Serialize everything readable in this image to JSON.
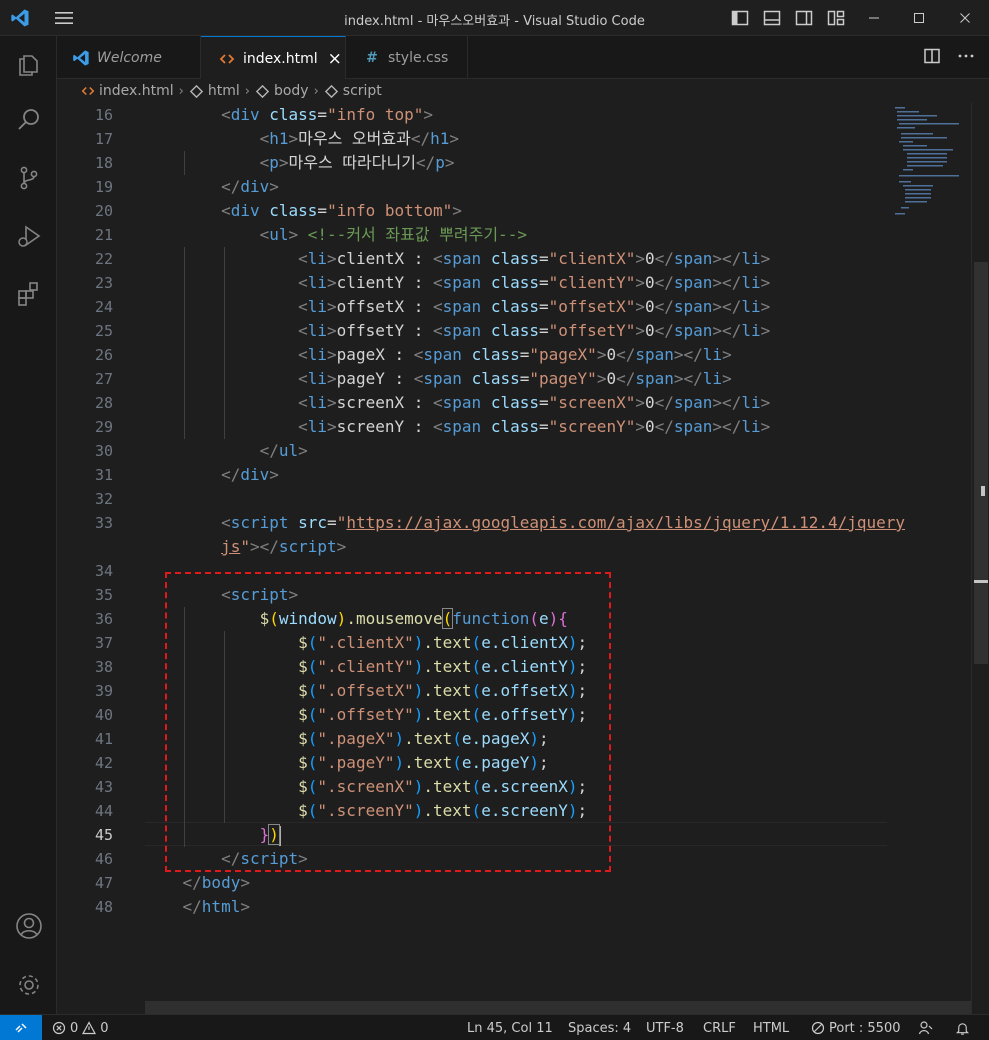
{
  "window": {
    "title": "index.html - 마우스오버효과 - Visual Studio Code"
  },
  "tabs": [
    {
      "label": "Welcome",
      "icon": "vscode-logo-icon",
      "active": false
    },
    {
      "label": "index.html",
      "icon": "html-file-icon",
      "active": true,
      "close": "×"
    },
    {
      "label": "style.css",
      "icon": "css-file-icon",
      "glyph": "#",
      "active": false
    }
  ],
  "breadcrumb": {
    "items": [
      "index.html",
      "html",
      "body",
      "script"
    ]
  },
  "editor": {
    "current_line": 45,
    "lines": [
      {
        "n": 16
      },
      {
        "n": 17
      },
      {
        "n": 18
      },
      {
        "n": 19
      },
      {
        "n": 20
      },
      {
        "n": 21
      },
      {
        "n": 22
      },
      {
        "n": 23
      },
      {
        "n": 24
      },
      {
        "n": 25
      },
      {
        "n": 26
      },
      {
        "n": 27
      },
      {
        "n": 28
      },
      {
        "n": 29
      },
      {
        "n": 30
      },
      {
        "n": 31
      },
      {
        "n": 32
      },
      {
        "n": 33
      },
      {
        "n": 34
      },
      {
        "n": 35
      },
      {
        "n": 36
      },
      {
        "n": 37
      },
      {
        "n": 38
      },
      {
        "n": 39
      },
      {
        "n": 40
      },
      {
        "n": 41
      },
      {
        "n": 42
      },
      {
        "n": 43
      },
      {
        "n": 44
      },
      {
        "n": 45
      },
      {
        "n": 46
      },
      {
        "n": 47
      },
      {
        "n": 48
      }
    ],
    "code": {
      "l16": {
        "tag": "div",
        "attr": "class",
        "val": "\"info top\""
      },
      "l17": {
        "tag": "h1",
        "text": "마우스 오버효과"
      },
      "l18": {
        "tag": "p",
        "text": "마우스 따라다니기"
      },
      "l19": {
        "tag": "div"
      },
      "l20": {
        "tag": "div",
        "attr": "class",
        "val": "\"info bottom\""
      },
      "l21": {
        "tag": "ul",
        "comment": "<!--커서 좌표값 뿌려주기-->"
      },
      "items": [
        {
          "label": "clientX",
          "cls": "\"clientX\""
        },
        {
          "label": "clientY",
          "cls": "\"clientY\""
        },
        {
          "label": "offsetX",
          "cls": "\"offsetX\""
        },
        {
          "label": "offsetY",
          "cls": "\"offsetY\""
        },
        {
          "label": "pageX",
          "cls": "\"pageX\""
        },
        {
          "label": "pageY",
          "cls": "\"pageY\""
        },
        {
          "label": "screenX",
          "cls": "\"screenX\""
        },
        {
          "label": "screenY",
          "cls": "\"screenY\""
        }
      ],
      "li_sep": " : ",
      "zero": "0",
      "l30": {
        "tag": "ul"
      },
      "l31": {
        "tag": "div"
      },
      "l33": {
        "tag": "script",
        "attr": "src",
        "quote": "\"",
        "url_a": "https://ajax.googleapis.com/ajax/libs/jquery/1.12.4/jquery",
        "url_b": "js"
      },
      "l35": {
        "tag": "script"
      },
      "l36": {
        "dollar": "$",
        "win": "window",
        "method": ".mousemove",
        "kw": "function",
        "param": "e"
      },
      "handlers": [
        {
          "sel": "\".clientX\"",
          "prop": "clientX"
        },
        {
          "sel": "\".clientY\"",
          "prop": "clientY"
        },
        {
          "sel": "\".offsetX\"",
          "prop": "offsetX"
        },
        {
          "sel": "\".offsetY\"",
          "prop": "offsetY"
        },
        {
          "sel": "\".pageX\"",
          "prop": "pageX"
        },
        {
          "sel": "\".pageY\"",
          "prop": "pageY"
        },
        {
          "sel": "\".screenX\"",
          "prop": "screenX"
        },
        {
          "sel": "\".screenY\"",
          "prop": "screenY"
        }
      ],
      "text_fn": ".text",
      "e_obj": "e.",
      "l46": {
        "tag": "script"
      },
      "l47": {
        "tag": "body"
      },
      "l48": {
        "tag": "html"
      }
    }
  },
  "statusbar": {
    "errors": "0",
    "warnings": "0",
    "position": "Ln 45, Col 11",
    "spaces": "Spaces: 4",
    "encoding": "UTF-8",
    "eol": "CRLF",
    "language": "HTML",
    "port": "Port : 5500"
  },
  "colors": {
    "accent": "#0078d4",
    "highlight_box": "#e01a1a"
  }
}
